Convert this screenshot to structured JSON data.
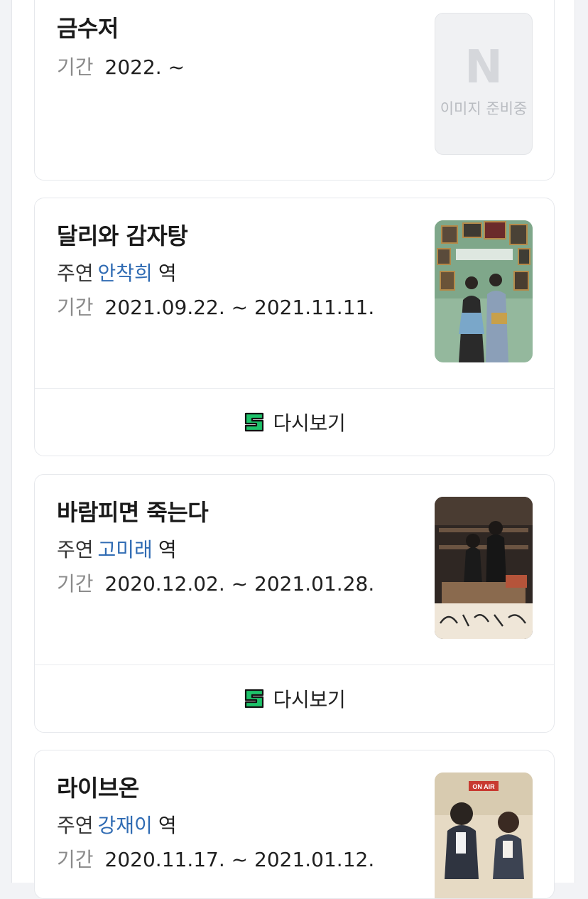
{
  "cards": [
    {
      "title": "금수저",
      "period_label": "기간",
      "period": "2022. ~",
      "thumb_placeholder_logo": "N",
      "thumb_placeholder_text": "이미지 준비중",
      "thumb_icon": "naver-n-logo"
    },
    {
      "title": "달리와 감자탕",
      "role_prefix": "주연",
      "role_name": "안착희",
      "role_suffix": "역",
      "period_label": "기간",
      "period": "2021.09.22. ~ 2021.11.11.",
      "replay_label": "다시보기",
      "replay_icon": "serieson-s-icon",
      "poster_colors": [
        "#8fb49a",
        "#4a5a48",
        "#c8cfc5"
      ]
    },
    {
      "title": "바람피면 죽는다",
      "role_prefix": "주연",
      "role_name": "고미래",
      "role_suffix": "역",
      "period_label": "기간",
      "period": "2020.12.02. ~ 2021.01.28.",
      "replay_label": "다시보기",
      "replay_icon": "serieson-s-icon",
      "poster_colors": [
        "#3a2f2a",
        "#8a6a52",
        "#e8dccb"
      ]
    },
    {
      "title": "라이브온",
      "role_prefix": "주연",
      "role_name": "강재이",
      "role_suffix": "역",
      "period_label": "기간",
      "period": "2020.11.17. ~ 2021.01.12.",
      "poster_badge": "ON AIR",
      "poster_colors": [
        "#e9dcc4",
        "#3a3f4a",
        "#c83a30"
      ]
    }
  ],
  "colors": {
    "role_link": "#2f6bb3",
    "label_gray": "#8a8a8a",
    "serieson_green": "#1ec26a"
  }
}
